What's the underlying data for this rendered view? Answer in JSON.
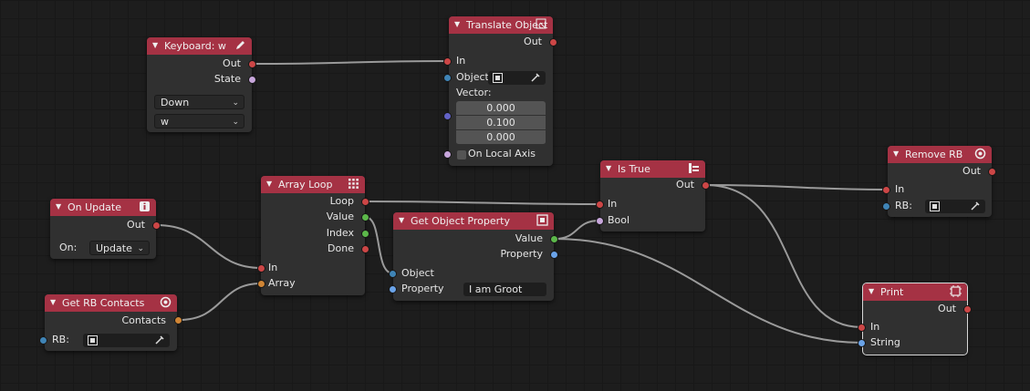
{
  "nodes": {
    "keyboard": {
      "title": "Keyboard: w",
      "out": "Out",
      "state": "State",
      "mode": "Down",
      "key": "w"
    },
    "translate": {
      "title": "Translate Object",
      "out": "Out",
      "in": "In",
      "object": "Object:",
      "vector": "Vector:",
      "v1": "0.000",
      "v2": "0.100",
      "v3": "0.000",
      "local": "On Local Axis"
    },
    "on_update": {
      "title": "On Update",
      "out": "Out",
      "on_label": "On:",
      "on_value": "Update"
    },
    "get_rb_contacts": {
      "title": "Get RB Contacts",
      "contacts": "Contacts",
      "rb": "RB:"
    },
    "array_loop": {
      "title": "Array Loop",
      "loop": "Loop",
      "value": "Value",
      "index": "Index",
      "done": "Done",
      "in": "In",
      "array": "Array"
    },
    "get_prop": {
      "title": "Get Object Property",
      "value": "Value",
      "property_out": "Property",
      "object": "Object",
      "property_in": "Property",
      "property_value": "I am Groot"
    },
    "is_true": {
      "title": "Is True",
      "out": "Out",
      "in": "In",
      "bool": "Bool"
    },
    "remove_rb": {
      "title": "Remove RB",
      "out": "Out",
      "in": "In",
      "rb": "RB:"
    },
    "print": {
      "title": "Print",
      "out": "Out",
      "in": "In",
      "string": "String"
    }
  },
  "colors": {
    "header": "#a53244",
    "node_body": "#303030",
    "execution_socket": "#cc4646",
    "object_socket": "#3f84b6",
    "data_socket": "#5cb84a",
    "list_socket": "#d08535",
    "string_socket": "#6aa3e8",
    "bool_socket": "#c7a6db",
    "vector_socket": "#6363c7",
    "link": "#9a9a9a"
  }
}
